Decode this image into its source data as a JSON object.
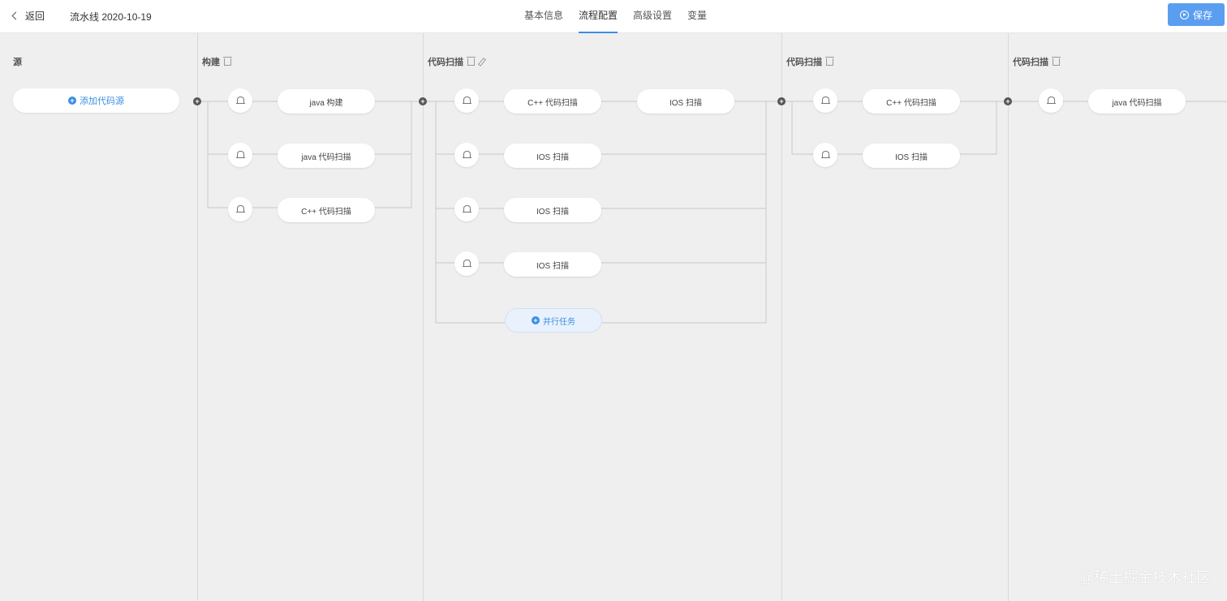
{
  "header": {
    "back_label": "返回",
    "title": "流水线 2020-10-19",
    "tabs": [
      "基本信息",
      "流程配置",
      "高级设置",
      "变量"
    ],
    "active_tab": "流程配置",
    "save_label": "保存"
  },
  "source": {
    "title": "源",
    "add_label": "添加代码源"
  },
  "stages": [
    {
      "title": "构建",
      "jobs": [
        "java 构建",
        "java 代码扫描",
        "C++ 代码扫描"
      ]
    },
    {
      "title": "代码扫描",
      "jobs": [
        "C++ 代码扫描",
        "IOS 扫描",
        "IOS 扫描",
        "IOS 扫描",
        "IOS 扫描"
      ],
      "parallel_label": "并行任务"
    },
    {
      "title": "代码扫描",
      "jobs": [
        "C++ 代码扫描",
        "IOS 扫描"
      ]
    },
    {
      "title": "代码扫描",
      "jobs": [
        "java 代码扫描"
      ]
    }
  ],
  "icons": {
    "back": "chevron-left-icon",
    "save": "play-circle-icon",
    "delete": "trash-icon",
    "edit": "pencil-icon",
    "notify": "bell-icon",
    "add": "plus-circle-icon"
  },
  "colors": {
    "accent": "#3a8ee6",
    "save_bg": "#5a9ef0",
    "canvas": "#efefef"
  },
  "watermark": "@稀土掘金技术社区"
}
